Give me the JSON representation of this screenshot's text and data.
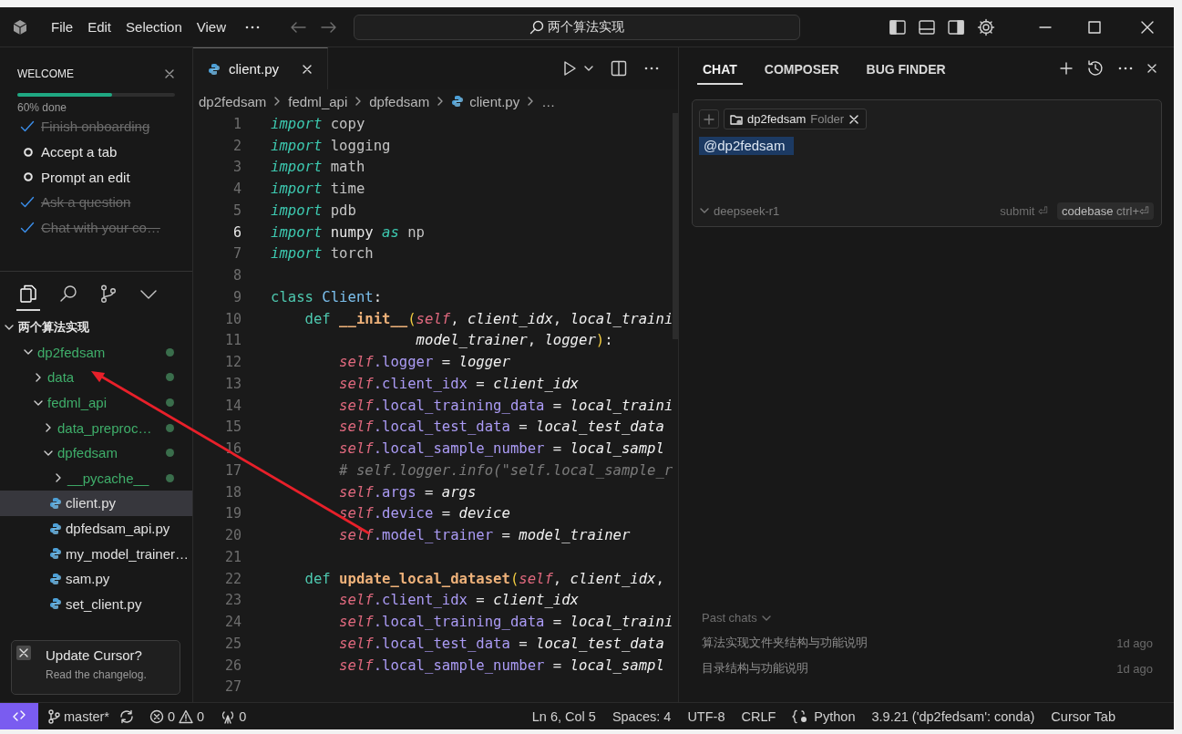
{
  "titlebar": {
    "menu": [
      "File",
      "Edit",
      "Selection",
      "View"
    ],
    "search": {
      "value": "两个算法实现"
    }
  },
  "welcome": {
    "title": "WELCOME",
    "level": 0.6,
    "progress_label": "60% done",
    "tasks": [
      {
        "label": "Finish onboarding",
        "done": true
      },
      {
        "label": "Accept a tab",
        "done": false
      },
      {
        "label": "Prompt an edit",
        "done": false
      },
      {
        "label": "Ask a question",
        "done": true
      },
      {
        "label": "Chat with your co…",
        "done": true
      }
    ]
  },
  "sidebar_tabs": [
    {
      "kind": "files",
      "selected": true
    },
    {
      "kind": "search",
      "selected": false
    },
    {
      "kind": "source-control",
      "selected": false
    },
    {
      "kind": "more",
      "selected": false
    }
  ],
  "explorer": {
    "items": [
      {
        "label": "两个算法实现",
        "kind": "workspace",
        "expanded": true,
        "selected": false,
        "untracked": false,
        "children": [
          {
            "label": "dp2fedsam",
            "kind": "folder",
            "expanded": true,
            "selected": false,
            "untracked": true,
            "children": [
              {
                "label": "data",
                "kind": "folder",
                "expanded": false,
                "selected": false,
                "untracked": true
              },
              {
                "label": "fedml_api",
                "kind": "folder",
                "expanded": true,
                "selected": false,
                "untracked": true,
                "children": [
                  {
                    "label": "data_preproc…",
                    "kind": "folder",
                    "expanded": false,
                    "selected": false,
                    "untracked": true
                  },
                  {
                    "label": "dpfedsam",
                    "kind": "folder",
                    "expanded": true,
                    "selected": false,
                    "untracked": true,
                    "children": [
                      {
                        "label": "__pycache__",
                        "kind": "folder",
                        "expanded": false,
                        "selected": false,
                        "untracked": true
                      },
                      {
                        "label": "client.py",
                        "kind": "python",
                        "selected": true,
                        "untracked": false
                      },
                      {
                        "label": "dpfedsam_api.py",
                        "kind": "python",
                        "selected": false,
                        "untracked": false
                      },
                      {
                        "label": "my_model_trainer…",
                        "kind": "python",
                        "selected": false,
                        "untracked": false
                      },
                      {
                        "label": "sam.py",
                        "kind": "python",
                        "selected": false,
                        "untracked": false
                      },
                      {
                        "label": "set_client.py",
                        "kind": "python",
                        "selected": false,
                        "untracked": false
                      }
                    ]
                  }
                ]
              }
            ]
          }
        ]
      }
    ]
  },
  "toast": {
    "title": "Update Cursor?",
    "message": "Read the changelog."
  },
  "editor": {
    "tabs": [
      {
        "label": "client.py",
        "selected": true
      }
    ],
    "breadcrumbs": [
      {
        "kind": "folder",
        "label": "dp2fedsam"
      },
      {
        "kind": "folder",
        "label": "fedml_api"
      },
      {
        "kind": "folder",
        "label": "dpfedsam"
      },
      {
        "kind": "python",
        "label": "client.py"
      },
      {
        "kind": "more",
        "label": "…"
      }
    ],
    "lines": [
      {
        "number": "1",
        "current": false,
        "tokens": [
          {
            "kind": "import",
            "text": "import"
          },
          {
            "kind": "module",
            "text": " copy"
          }
        ]
      },
      {
        "number": "2",
        "current": false,
        "tokens": [
          {
            "kind": "import",
            "text": "import"
          },
          {
            "kind": "module",
            "text": " logging"
          }
        ]
      },
      {
        "number": "3",
        "current": false,
        "tokens": [
          {
            "kind": "import",
            "text": "import"
          },
          {
            "kind": "module",
            "text": " math"
          }
        ]
      },
      {
        "number": "4",
        "current": false,
        "tokens": [
          {
            "kind": "import",
            "text": "import"
          },
          {
            "kind": "module",
            "text": " time"
          }
        ]
      },
      {
        "number": "5",
        "current": false,
        "tokens": [
          {
            "kind": "import",
            "text": "import"
          },
          {
            "kind": "module",
            "text": " pdb"
          }
        ]
      },
      {
        "number": "6",
        "current": true,
        "tokens": [
          {
            "kind": "import",
            "text": "import"
          },
          {
            "kind": "op",
            "text": " numpy "
          },
          {
            "kind": "import",
            "text": "as"
          },
          {
            "kind": "module",
            "text": " np"
          }
        ]
      },
      {
        "number": "7",
        "current": false,
        "tokens": [
          {
            "kind": "import",
            "text": "import"
          },
          {
            "kind": "module",
            "text": " torch"
          }
        ]
      },
      {
        "number": "8",
        "current": false
      },
      {
        "number": "9",
        "current": false,
        "tokens": [
          {
            "kind": "keyword",
            "text": "class"
          },
          {
            "kind": "class",
            "text": " Client"
          },
          {
            "kind": "op",
            "text": ":"
          }
        ]
      },
      {
        "number": "10",
        "current": false,
        "tokens": [
          {
            "kind": "keyword",
            "text": "    def"
          },
          {
            "kind": "func",
            "text": " __init__"
          },
          {
            "kind": "paren",
            "text": "("
          },
          {
            "kind": "self",
            "text": "self"
          },
          {
            "kind": "op",
            "text": ", "
          },
          {
            "kind": "param",
            "text": "client_idx"
          },
          {
            "kind": "op",
            "text": ", "
          },
          {
            "kind": "param",
            "text": "local_traini"
          }
        ]
      },
      {
        "number": "11",
        "current": false,
        "tokens": [
          {
            "kind": "param",
            "text": "                 model_trainer"
          },
          {
            "kind": "op",
            "text": ", "
          },
          {
            "kind": "param",
            "text": "logger"
          },
          {
            "kind": "paren",
            "text": ")"
          },
          {
            "kind": "op",
            "text": ":"
          }
        ]
      },
      {
        "number": "12",
        "current": false,
        "tokens": [
          {
            "kind": "self",
            "text": "        self"
          },
          {
            "kind": "attr",
            "text": ".logger"
          },
          {
            "kind": "op",
            "text": " = "
          },
          {
            "kind": "param",
            "text": "logger"
          }
        ]
      },
      {
        "number": "13",
        "current": false,
        "tokens": [
          {
            "kind": "self",
            "text": "        self"
          },
          {
            "kind": "attr",
            "text": ".client_idx"
          },
          {
            "kind": "op",
            "text": " = "
          },
          {
            "kind": "param",
            "text": "client_idx"
          }
        ]
      },
      {
        "number": "14",
        "current": false,
        "tokens": [
          {
            "kind": "self",
            "text": "        self"
          },
          {
            "kind": "attr",
            "text": ".local_training_data"
          },
          {
            "kind": "op",
            "text": " = "
          },
          {
            "kind": "param",
            "text": "local_traini"
          }
        ]
      },
      {
        "number": "15",
        "current": false,
        "tokens": [
          {
            "kind": "self",
            "text": "        self"
          },
          {
            "kind": "attr",
            "text": ".local_test_data"
          },
          {
            "kind": "op",
            "text": " = "
          },
          {
            "kind": "param",
            "text": "local_test_data"
          }
        ]
      },
      {
        "number": "16",
        "current": false,
        "tokens": [
          {
            "kind": "self",
            "text": "        self"
          },
          {
            "kind": "attr",
            "text": ".local_sample_number"
          },
          {
            "kind": "op",
            "text": " = "
          },
          {
            "kind": "param",
            "text": "local_sampl"
          }
        ]
      },
      {
        "number": "17",
        "current": false,
        "tokens": [
          {
            "kind": "comment",
            "text": "        # self.logger.info(\"self.local_sample_r"
          }
        ]
      },
      {
        "number": "18",
        "current": false,
        "tokens": [
          {
            "kind": "self",
            "text": "        self"
          },
          {
            "kind": "attr",
            "text": ".args"
          },
          {
            "kind": "op",
            "text": " = "
          },
          {
            "kind": "param",
            "text": "args"
          }
        ]
      },
      {
        "number": "19",
        "current": false,
        "tokens": [
          {
            "kind": "self",
            "text": "        self"
          },
          {
            "kind": "attr",
            "text": ".device"
          },
          {
            "kind": "op",
            "text": " = "
          },
          {
            "kind": "param",
            "text": "device"
          }
        ]
      },
      {
        "number": "20",
        "current": false,
        "tokens": [
          {
            "kind": "self",
            "text": "        self"
          },
          {
            "kind": "attr",
            "text": ".model_trainer"
          },
          {
            "kind": "op",
            "text": " = "
          },
          {
            "kind": "param",
            "text": "model_trainer"
          }
        ]
      },
      {
        "number": "21",
        "current": false
      },
      {
        "number": "22",
        "current": false,
        "tokens": [
          {
            "kind": "keyword",
            "text": "    def"
          },
          {
            "kind": "func",
            "text": " update_local_dataset"
          },
          {
            "kind": "paren",
            "text": "("
          },
          {
            "kind": "self",
            "text": "self"
          },
          {
            "kind": "op",
            "text": ", "
          },
          {
            "kind": "param",
            "text": "client_idx"
          },
          {
            "kind": "op",
            "text": ","
          }
        ]
      },
      {
        "number": "23",
        "current": false,
        "tokens": [
          {
            "kind": "self",
            "text": "        self"
          },
          {
            "kind": "attr",
            "text": ".client_idx"
          },
          {
            "kind": "op",
            "text": " = "
          },
          {
            "kind": "param",
            "text": "client_idx"
          }
        ]
      },
      {
        "number": "24",
        "current": false,
        "tokens": [
          {
            "kind": "self",
            "text": "        self"
          },
          {
            "kind": "attr",
            "text": ".local_training_data"
          },
          {
            "kind": "op",
            "text": " = "
          },
          {
            "kind": "param",
            "text": "local_traini"
          }
        ]
      },
      {
        "number": "25",
        "current": false,
        "tokens": [
          {
            "kind": "self",
            "text": "        self"
          },
          {
            "kind": "attr",
            "text": ".local_test_data"
          },
          {
            "kind": "op",
            "text": " = "
          },
          {
            "kind": "param",
            "text": "local_test_data"
          }
        ]
      },
      {
        "number": "26",
        "current": false,
        "tokens": [
          {
            "kind": "self",
            "text": "        self"
          },
          {
            "kind": "attr",
            "text": ".local_sample_number"
          },
          {
            "kind": "op",
            "text": " = "
          },
          {
            "kind": "param",
            "text": "local_sampl"
          }
        ]
      },
      {
        "number": "27",
        "current": false
      }
    ]
  },
  "chat": {
    "tabs": [
      {
        "label": "CHAT",
        "selected": true
      },
      {
        "label": "COMPOSER",
        "selected": false
      },
      {
        "label": "BUG FINDER",
        "selected": false
      }
    ],
    "context_chip": {
      "label": "dp2fedsam",
      "type": "Folder"
    },
    "input_value": "@dp2fedsam",
    "model": "deepseek-r1",
    "submit_label": "submit",
    "submit_key": "⏎",
    "codebase_label": "codebase",
    "codebase_key": "ctrl+⏎",
    "past_chats_label": "Past chats",
    "past_chats": [
      {
        "title": "算法实现文件夹结构与功能说明",
        "time": "1d ago"
      },
      {
        "title": "目录结构与功能说明",
        "time": "1d ago"
      }
    ]
  },
  "status_bar": {
    "branch": "master*",
    "errors": "0",
    "warnings": "0",
    "ports": "0",
    "items": [
      {
        "kind": "text",
        "label": "Ln 6, Col 5"
      },
      {
        "kind": "text",
        "label": "Spaces: 4"
      },
      {
        "kind": "text",
        "label": "UTF-8"
      },
      {
        "kind": "text",
        "label": "CRLF"
      },
      {
        "kind": "language",
        "label": "Python"
      },
      {
        "kind": "text",
        "label": "3.9.21 ('dp2fedsam': conda)"
      },
      {
        "kind": "text",
        "label": "Cursor Tab"
      }
    ]
  },
  "annotations": [
    {
      "kind": "arrow"
    }
  ]
}
